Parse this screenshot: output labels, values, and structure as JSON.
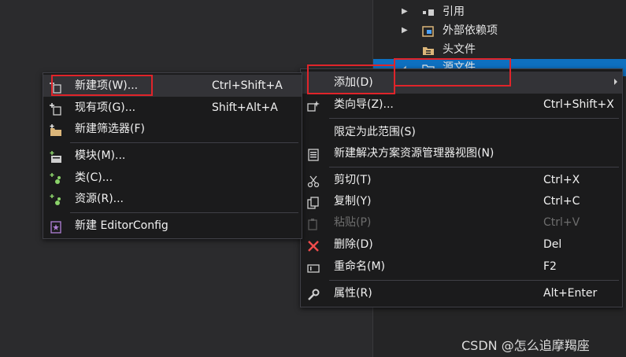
{
  "solution_explorer": {
    "items": [
      {
        "label": "引用",
        "expanded": false,
        "icon": "references-icon"
      },
      {
        "label": "外部依赖项",
        "expanded": false,
        "icon": "external-dependencies-icon"
      },
      {
        "label": "头文件",
        "expanded": false,
        "icon": "header-files-folder-icon"
      },
      {
        "label": "源文件",
        "expanded": true,
        "icon": "source-files-folder-icon",
        "selected": true
      }
    ]
  },
  "context_menu": {
    "items": [
      {
        "label": "添加(D)",
        "shortcut": "",
        "icon": "",
        "submenu": true
      },
      {
        "label": "类向导(Z)...",
        "shortcut": "Ctrl+Shift+X",
        "icon": "class-wizard-icon"
      },
      {
        "label": "限定为此范围(S)",
        "shortcut": "",
        "icon": ""
      },
      {
        "label": "新建解决方案资源管理器视图(N)",
        "shortcut": "",
        "icon": "new-explorer-view-icon"
      },
      {
        "label": "剪切(T)",
        "shortcut": "Ctrl+X",
        "icon": "scissors-icon"
      },
      {
        "label": "复制(Y)",
        "shortcut": "Ctrl+C",
        "icon": "copy-icon"
      },
      {
        "label": "粘贴(P)",
        "shortcut": "Ctrl+V",
        "icon": "paste-icon",
        "disabled": true
      },
      {
        "label": "删除(D)",
        "shortcut": "Del",
        "icon": "delete-x-icon"
      },
      {
        "label": "重命名(M)",
        "shortcut": "F2",
        "icon": "rename-icon"
      },
      {
        "label": "属性(R)",
        "shortcut": "Alt+Enter",
        "icon": "wrench-icon"
      }
    ]
  },
  "add_submenu": {
    "items": [
      {
        "label": "新建项(W)...",
        "shortcut": "Ctrl+Shift+A",
        "icon": "new-item-icon"
      },
      {
        "label": "现有项(G)...",
        "shortcut": "Shift+Alt+A",
        "icon": "existing-item-icon"
      },
      {
        "label": "新建筛选器(F)",
        "shortcut": "",
        "icon": "new-filter-folder-icon"
      },
      {
        "label": "模块(M)...",
        "shortcut": "",
        "icon": "module-icon"
      },
      {
        "label": "类(C)...",
        "shortcut": "",
        "icon": "class-icon"
      },
      {
        "label": "资源(R)...",
        "shortcut": "",
        "icon": "resource-icon"
      },
      {
        "label": "新建 EditorConfig",
        "shortcut": "",
        "icon": "editorconfig-icon"
      }
    ]
  },
  "watermark": "CSDN @怎么追摩羯座",
  "colors": {
    "accent_red": "#e0242a",
    "selection_blue": "#0e70c0",
    "menu_bg": "#1b1b1c"
  }
}
